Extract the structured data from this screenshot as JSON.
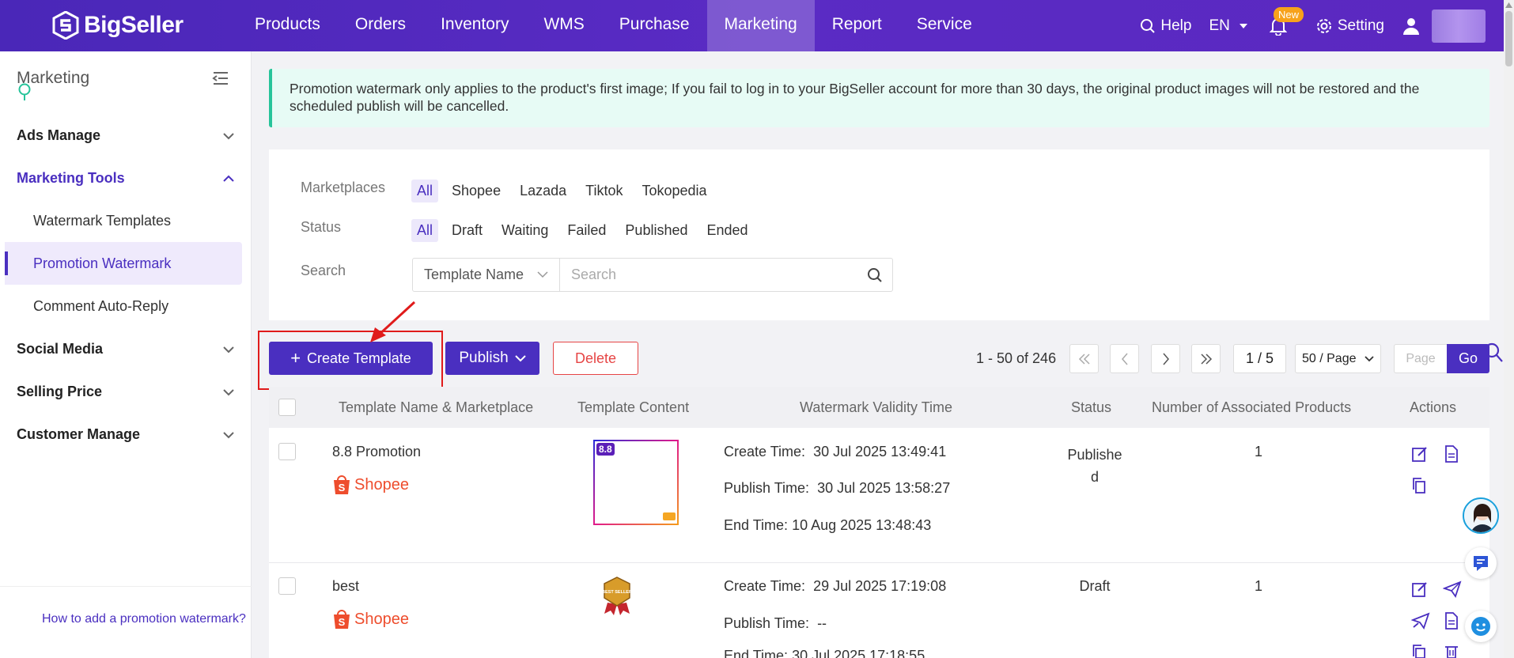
{
  "brand": {
    "name": "BigSeller"
  },
  "nav": {
    "items": [
      "Products",
      "Orders",
      "Inventory",
      "WMS",
      "Purchase",
      "Marketing",
      "Report",
      "Service"
    ],
    "active": "Marketing"
  },
  "topright": {
    "help": "Help",
    "lang": "EN",
    "new_badge": "New",
    "setting": "Setting"
  },
  "sidebar": {
    "title": "Marketing",
    "groups": [
      {
        "label": "Ads Manage"
      },
      {
        "label": "Marketing Tools",
        "children": [
          "Watermark Templates",
          "Promotion Watermark",
          "Comment Auto-Reply"
        ],
        "active_child": "Promotion Watermark"
      },
      {
        "label": "Social Media"
      },
      {
        "label": "Selling Price"
      },
      {
        "label": "Customer Manage"
      }
    ],
    "help_link": "How to add a promotion watermark?"
  },
  "notice": "Promotion watermark only applies to the product's first image; If you fail to log in to your BigSeller account for more than 30 days, the original product images will not be restored and the scheduled publish will be cancelled.",
  "filters": {
    "marketplaces_label": "Marketplaces",
    "marketplaces": [
      "All",
      "Shopee",
      "Lazada",
      "Tiktok",
      "Tokopedia"
    ],
    "status_label": "Status",
    "statuses": [
      "All",
      "Draft",
      "Waiting",
      "Failed",
      "Published",
      "Ended"
    ],
    "search_label": "Search",
    "search_type": "Template Name",
    "search_placeholder": "Search"
  },
  "toolbar": {
    "create": "Create Template",
    "publish": "Publish",
    "delete": "Delete"
  },
  "pager": {
    "info": "1 - 50 of 246",
    "page": "1 / 5",
    "page_size": "50 / Page",
    "page_placeholder": "Page",
    "go": "Go"
  },
  "table": {
    "headers": [
      "Template Name & Marketplace",
      "Template Content",
      "Watermark Validity Time",
      "Status",
      "Number of Associated Products",
      "Actions"
    ],
    "rows": [
      {
        "name": "8.8 Promotion",
        "marketplace": "Shopee",
        "create_label": "Create Time:",
        "create_time": "30 Jul 2025 13:49:41",
        "publish_label": "Publish Time:",
        "publish_time": "30 Jul 2025 13:58:27",
        "end_label": "End Time:",
        "end_time": "10 Aug 2025 13:48:43",
        "status_line1": "Publishe",
        "status_line2": "d",
        "products": "1",
        "thumb_text": "8.8"
      },
      {
        "name": "best",
        "marketplace": "Shopee",
        "create_label": "Create Time:",
        "create_time": "29 Jul 2025 17:19:08",
        "publish_label": "Publish Time:",
        "publish_time": "--",
        "end_label": "End Time:",
        "end_time": "30 Jul 2025 17:18:55",
        "status_line1": "Draft",
        "status_line2": "",
        "products": "1",
        "thumb_text": "BEST SELLER"
      }
    ]
  },
  "colors": {
    "primary": "#4a2fc0",
    "accent_red": "#e01b1b",
    "shopee": "#ee4d2d",
    "notice_bg": "#e7fbf5"
  }
}
